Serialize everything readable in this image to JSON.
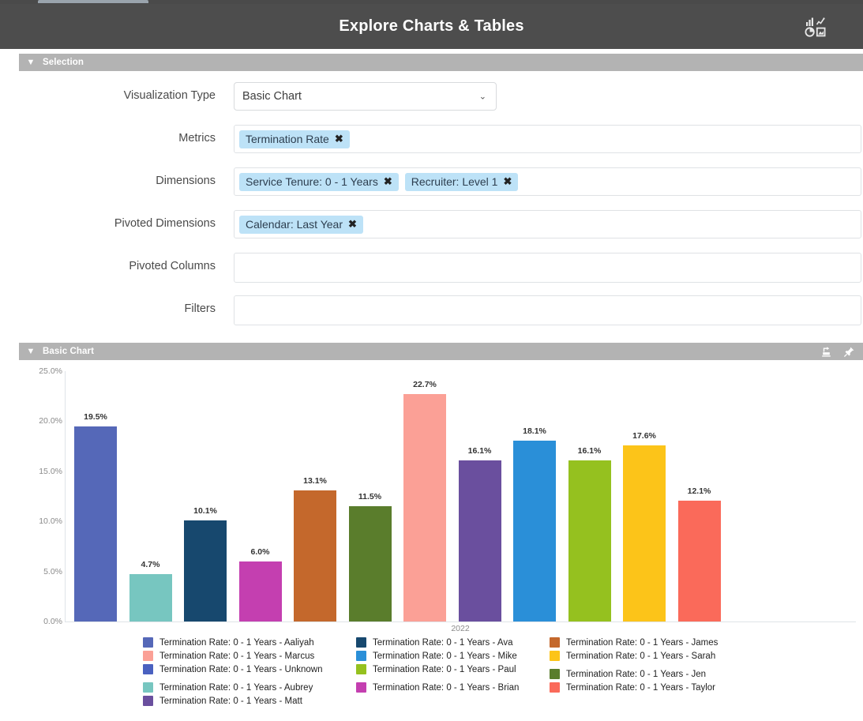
{
  "header": {
    "title": "Explore Charts & Tables",
    "icon": "charts-tables-icon"
  },
  "selection_panel": {
    "title": "Selection",
    "caret": "▼",
    "rows": {
      "visualization_type": {
        "label": "Visualization Type",
        "value": "Basic Chart",
        "caret": "⌄",
        "options": [
          "Basic Chart"
        ]
      },
      "metrics": {
        "label": "Metrics",
        "tokens": [
          "Termination Rate"
        ],
        "remove_glyph": "✖"
      },
      "dimensions": {
        "label": "Dimensions",
        "tokens": [
          "Service Tenure: 0 - 1 Years",
          "Recruiter: Level 1"
        ],
        "remove_glyph": "✖"
      },
      "pivoted_dimensions": {
        "label": "Pivoted Dimensions",
        "tokens": [
          "Calendar: Last Year"
        ],
        "remove_glyph": "✖"
      },
      "pivoted_columns": {
        "label": "Pivoted Columns",
        "tokens": [],
        "placeholder": ""
      },
      "filters": {
        "label": "Filters",
        "tokens": [],
        "placeholder": ""
      }
    }
  },
  "chart_panel": {
    "title": "Basic Chart",
    "caret": "▼",
    "actions": [
      {
        "name": "export-icon"
      },
      {
        "name": "pin-icon"
      }
    ]
  },
  "chart_data": {
    "type": "bar",
    "title": "Basic Chart",
    "xlabel": "2022",
    "ylabel": "",
    "ylim": [
      0,
      25
    ],
    "ytick_labels": [
      "25.0%",
      "20.0%",
      "15.0%",
      "10.0%",
      "5.0%",
      "0.0%"
    ],
    "ytick_values": [
      25,
      20,
      15,
      10,
      5,
      0
    ],
    "grid": false,
    "legend_position": "bottom",
    "categories": [
      "Termination Rate: 0 - 1 Years - Aaliyah",
      "Termination Rate: 0 - 1 Years - Aubrey",
      "Termination Rate: 0 - 1 Years - Ava",
      "Termination Rate: 0 - 1 Years - Brian",
      "Termination Rate: 0 - 1 Years - James",
      "Termination Rate: 0 - 1 Years - Jen",
      "Termination Rate: 0 - 1 Years - Marcus",
      "Termination Rate: 0 - 1 Years - Matt",
      "Termination Rate: 0 - 1 Years - Mike",
      "Termination Rate: 0 - 1 Years - Paul",
      "Termination Rate: 0 - 1 Years - Sarah",
      "Termination Rate: 0 - 1 Years - Taylor"
    ],
    "values": [
      19.5,
      4.7,
      10.1,
      6.0,
      13.1,
      11.5,
      22.7,
      16.1,
      18.1,
      16.1,
      17.6,
      12.1
    ],
    "value_labels": [
      "19.5%",
      "4.7%",
      "10.1%",
      "6.0%",
      "13.1%",
      "11.5%",
      "22.7%",
      "16.1%",
      "18.1%",
      "16.1%",
      "17.6%",
      "12.1%"
    ],
    "colors": [
      "#5568b8",
      "#77c6c0",
      "#17486e",
      "#c43fb0",
      "#c4682c",
      "#5a7d2c",
      "#fba096",
      "#6a4f9e",
      "#2a8fd8",
      "#95c11f",
      "#fcc419",
      "#fa6a5a"
    ],
    "bars": [
      {
        "label": "Termination Rate: 0 - 1 Years - Aaliyah",
        "value": 19.5,
        "value_label": "19.5%",
        "color": "#5568b8"
      },
      {
        "label": "Termination Rate: 0 - 1 Years - Aubrey",
        "value": 4.7,
        "value_label": "4.7%",
        "color": "#77c6c0"
      },
      {
        "label": "Termination Rate: 0 - 1 Years - Ava",
        "value": 10.1,
        "value_label": "10.1%",
        "color": "#17486e"
      },
      {
        "label": "Termination Rate: 0 - 1 Years - Brian",
        "value": 6.0,
        "value_label": "6.0%",
        "color": "#c43fb0"
      },
      {
        "label": "Termination Rate: 0 - 1 Years - James",
        "value": 13.1,
        "value_label": "13.1%",
        "color": "#c4682c"
      },
      {
        "label": "Termination Rate: 0 - 1 Years - Jen",
        "value": 11.5,
        "value_label": "11.5%",
        "color": "#5a7d2c"
      },
      {
        "label": "Termination Rate: 0 - 1 Years - Marcus",
        "value": 22.7,
        "value_label": "22.7%",
        "color": "#fba096"
      },
      {
        "label": "Termination Rate: 0 - 1 Years - Matt",
        "value": 16.1,
        "value_label": "16.1%",
        "color": "#6a4f9e"
      },
      {
        "label": "Termination Rate: 0 - 1 Years - Mike",
        "value": 18.1,
        "value_label": "18.1%",
        "color": "#2a8fd8"
      },
      {
        "label": "Termination Rate: 0 - 1 Years - Paul",
        "value": 16.1,
        "value_label": "16.1%",
        "color": "#95c11f"
      },
      {
        "label": "Termination Rate: 0 - 1 Years - Sarah",
        "value": 17.6,
        "value_label": "17.6%",
        "color": "#fcc419"
      },
      {
        "label": "Termination Rate: 0 - 1 Years - Taylor",
        "value": 12.1,
        "value_label": "12.1%",
        "color": "#fa6a5a"
      }
    ],
    "legend_columns": [
      [
        {
          "label": "Termination Rate: 0 - 1 Years - Aaliyah",
          "color": "#5568b8",
          "gap": false
        },
        {
          "label": "Termination Rate: 0 - 1 Years - Marcus",
          "color": "#fba096",
          "gap": false
        },
        {
          "label": "Termination Rate: 0 - 1 Years - Unknown",
          "color": "#4a61c0",
          "gap": false
        },
        {
          "label": "Termination Rate: 0 - 1 Years - Aubrey",
          "color": "#77c6c0",
          "gap": true
        },
        {
          "label": "Termination Rate: 0 - 1 Years - Matt",
          "color": "#6a4f9e",
          "gap": false
        }
      ],
      [
        {
          "label": "Termination Rate: 0 - 1 Years - Ava",
          "color": "#17486e",
          "gap": false
        },
        {
          "label": "Termination Rate: 0 - 1 Years - Mike",
          "color": "#2a8fd8",
          "gap": false
        },
        {
          "label": "Termination Rate: 0 - 1 Years - Paul",
          "color": "#95c11f",
          "gap": false
        },
        {
          "label": "Termination Rate: 0 - 1 Years - Brian",
          "color": "#c43fb0",
          "gap": true
        }
      ],
      [
        {
          "label": "Termination Rate: 0 - 1 Years - James",
          "color": "#c4682c",
          "gap": false
        },
        {
          "label": "Termination Rate: 0 - 1 Years - Sarah",
          "color": "#fcc419",
          "gap": false
        },
        {
          "label": "Termination Rate: 0 - 1 Years - Jen",
          "color": "#5a7d2c",
          "gap": true
        },
        {
          "label": "Termination Rate: 0 - 1 Years - Taylor",
          "color": "#fa6a5a",
          "gap": false
        }
      ]
    ]
  }
}
